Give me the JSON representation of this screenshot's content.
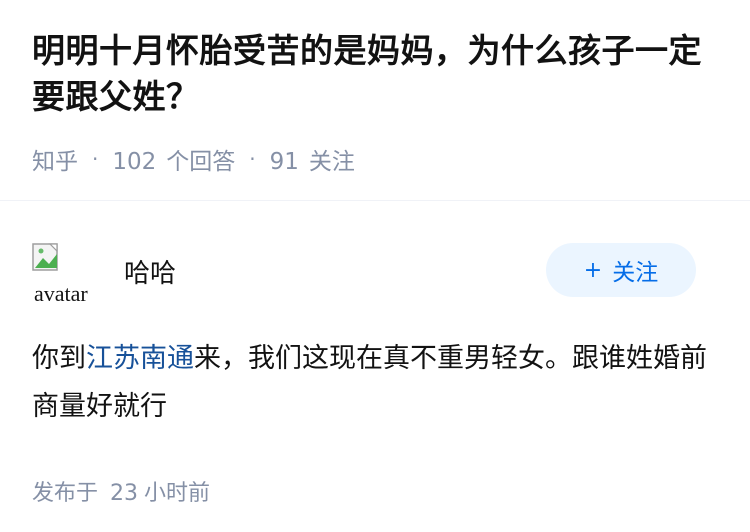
{
  "question": {
    "title": "明明十月怀胎受苦的是妈妈，为什么孩子一定要跟父姓？",
    "source": "知乎",
    "separator": "·",
    "answer_count": "102",
    "answer_label": "个回答",
    "follow_count": "91",
    "follow_label": "关注"
  },
  "answer": {
    "avatar_alt": "avatar",
    "author": "哈哈",
    "follow_button": {
      "icon": "+",
      "label": "关注"
    },
    "content": {
      "before": "你到",
      "link": "江苏南通",
      "after": "来，我们这现在真不重男轻女。跟谁姓婚前商量好就行"
    },
    "time": {
      "prefix": "发布于",
      "value": "23",
      "unit": "小时前"
    }
  },
  "colors": {
    "meta": "#8590a6",
    "link": "#175199",
    "brand": "#056de8",
    "follow_bg": "#ebf5ff",
    "divider": "#f0f2f7"
  }
}
